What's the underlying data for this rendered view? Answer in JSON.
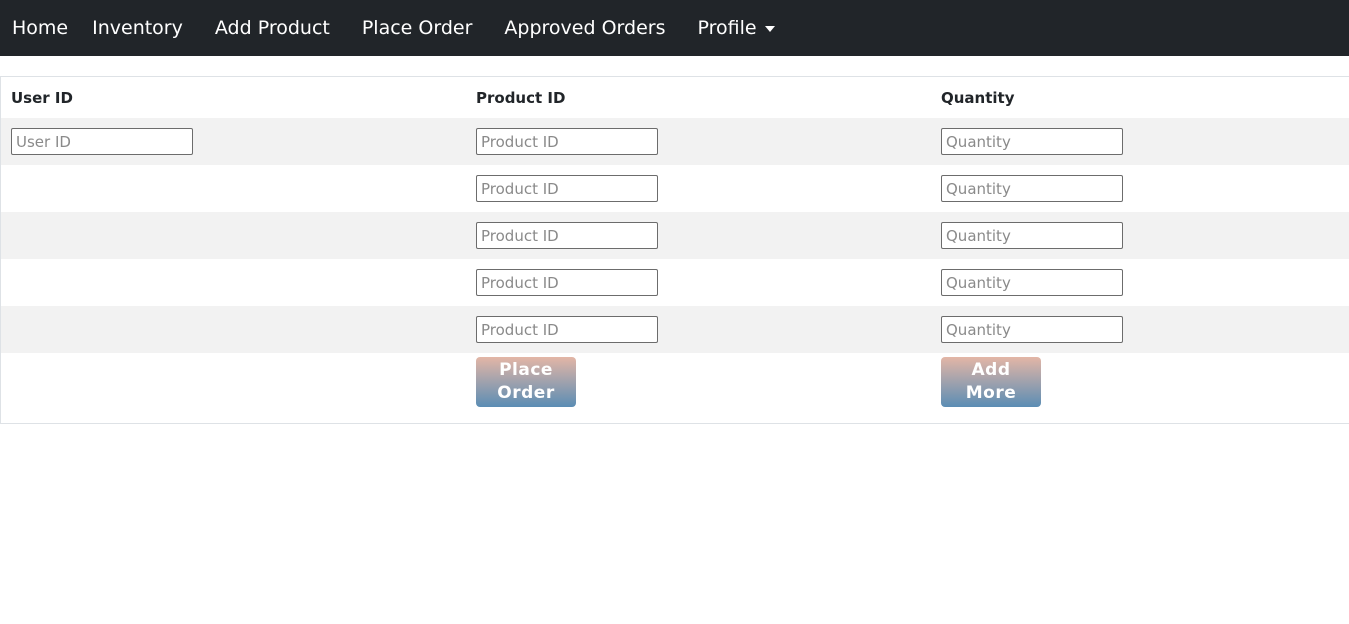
{
  "nav": {
    "items": [
      "Home",
      "Inventory",
      "Add Product",
      "Place Order",
      "Approved Orders"
    ],
    "profile_label": "Profile"
  },
  "table": {
    "headers": [
      "User ID",
      "Product ID",
      "Quantity"
    ],
    "placeholders": {
      "user_id": "User ID",
      "product_id": "Product ID",
      "quantity": "Quantity"
    }
  },
  "buttons": {
    "place_order_line1": "Place",
    "place_order_line2": "Order",
    "add_more_line1": "Add",
    "add_more_line2": "More"
  },
  "colors": {
    "navbar": "#212529",
    "row_shade": "#f2f2f2",
    "button_gradient_top": "#e3b6a6",
    "button_gradient_bottom": "#5b8db4"
  }
}
